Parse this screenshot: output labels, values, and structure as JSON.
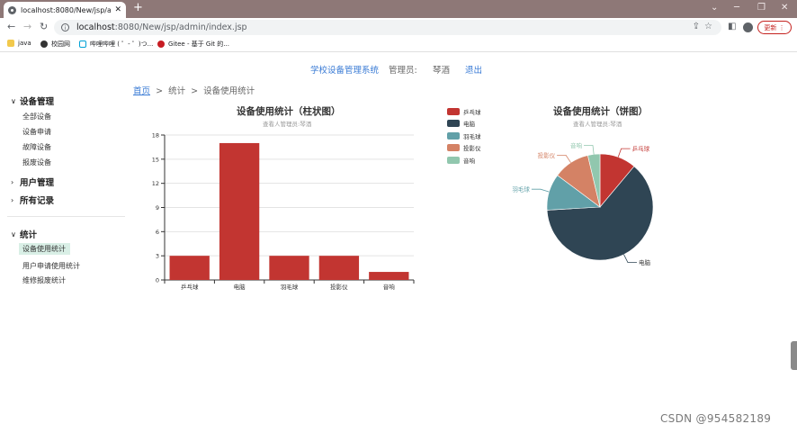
{
  "browser": {
    "tab_title": "localhost:8080/New/jsp/admi",
    "tab_close": "✕",
    "new_tab": "+",
    "url_host": "localhost",
    "url_path": ":8080/New/jsp/admin/index.jsp",
    "update_label": "更新 ⋮",
    "bookmarks": [
      {
        "label": "java",
        "icon": "folder-icon"
      },
      {
        "label": "校园网",
        "icon": "globe-icon"
      },
      {
        "label": "哔哩哔哩 ( ゜- ゜)つ...",
        "icon": "tv-icon"
      },
      {
        "label": "Gitee - 基于 Git 的...",
        "icon": "gitee-icon"
      }
    ]
  },
  "header": {
    "site_name": "学校设备管理系统",
    "admin_label": "管理员:",
    "admin_name": "琴酒",
    "logout": "退出"
  },
  "sidebar": {
    "equipment_group": "设备管理",
    "equipment_items": [
      "全部设备",
      "设备申请",
      "故障设备",
      "报废设备"
    ],
    "user_group": "用户管理",
    "records_group": "所有记录",
    "stats_group": "统计",
    "stats_items": [
      "设备使用统计",
      "用户申请使用统计",
      "维修报废统计"
    ],
    "active_item": "设备使用统计"
  },
  "breadcrumb": {
    "home": "首页",
    "sep1": ">",
    "level1": "统计",
    "sep2": ">",
    "level2": "设备使用统计"
  },
  "legend": {
    "colors": [
      "#c23531",
      "#2f4554",
      "#61a0a8",
      "#d48265",
      "#91c7ae"
    ]
  },
  "watermark": "CSDN @954582189",
  "chart_data": [
    {
      "type": "bar",
      "title": "设备使用统计（柱状图）",
      "subtitle": "查看人管理员:琴酒",
      "categories": [
        "乒乓球",
        "电脑",
        "羽毛球",
        "投影仪",
        "音响"
      ],
      "values": [
        3,
        17,
        3,
        3,
        1
      ],
      "ylim": [
        0,
        18
      ],
      "yticks": [
        0,
        3,
        6,
        9,
        12,
        15,
        18
      ],
      "color": "#c23531",
      "grid": true
    },
    {
      "type": "pie",
      "title": "设备使用统计（饼图）",
      "subtitle": "查看人管理员:琴酒",
      "labels": [
        "乒乓球",
        "电脑",
        "羽毛球",
        "投影仪",
        "音响"
      ],
      "values": [
        3,
        17,
        3,
        3,
        1
      ],
      "colors": [
        "#c23531",
        "#2f4554",
        "#61a0a8",
        "#d48265",
        "#91c7ae"
      ],
      "legend": "left"
    }
  ]
}
